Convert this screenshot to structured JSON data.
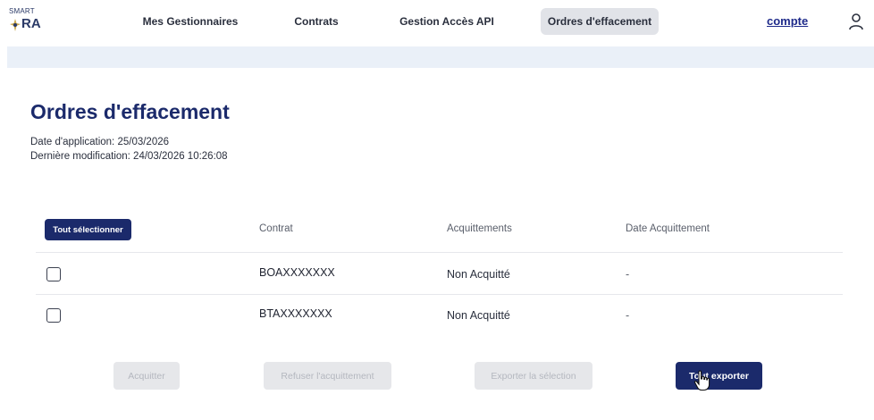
{
  "logo": {
    "top_text": "SMART",
    "mark_text": "RA"
  },
  "nav": {
    "items": [
      {
        "label": "Mes Gestionnaires"
      },
      {
        "label": "Contrats"
      },
      {
        "label": "Gestion Accès API"
      },
      {
        "label": "Ordres d'effacement",
        "active": true
      }
    ],
    "account_label": "compte",
    "user_icon": "user-icon"
  },
  "page": {
    "title": "Ordres d'effacement",
    "application_date": "Date d'application: 25/03/2026",
    "last_modified": "Dernière modification: 24/03/2026 10:26:08"
  },
  "table": {
    "select_all_label": "Tout sélectionner",
    "headers": [
      "Contrat",
      "Acquittements",
      "Date Acquittement"
    ],
    "rows": [
      {
        "checked": false,
        "contrat": "BOAXXXXXXX",
        "acquittement": "Non Acquitté",
        "date": "-"
      },
      {
        "checked": false,
        "contrat": "BTAXXXXXXX",
        "acquittement": "Non Acquitté",
        "date": "-"
      }
    ]
  },
  "actions": {
    "acquitter": "Acquitter",
    "refuser": "Refuser l'acquittement",
    "exporter_selection": "Exporter la sélection",
    "tout_exporter": "Tout exporter"
  },
  "colors": {
    "primary": "#1b2a6b",
    "nav_active_bg": "#e1e3e8",
    "band": "#eaf0f8",
    "disabled_bg": "#e6e7ea",
    "disabled_text": "#b4b7bf"
  }
}
